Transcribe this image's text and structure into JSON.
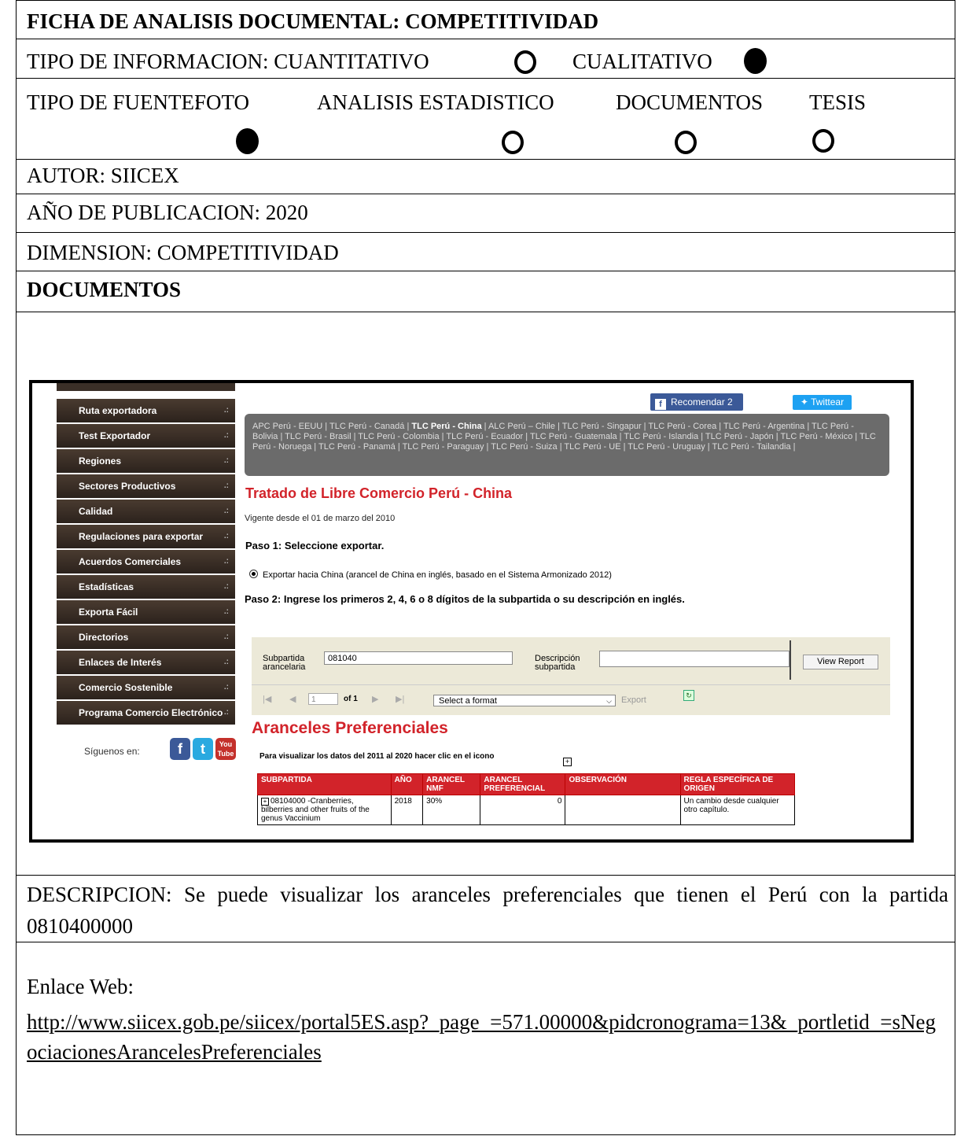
{
  "title": "FICHA DE ANALISIS DOCUMENTAL: COMPETITIVIDAD",
  "tipo_informacion": {
    "label": "TIPO DE INFORMACION: CUANTITATIVO",
    "cualitativo": "CUALITATIVO",
    "selected": "CUALITATIVO"
  },
  "tipo_fuente": {
    "label": "TIPO DE FUENTE:",
    "options": [
      "FOTO",
      "ANALISIS ESTADISTICO",
      "DOCUMENTOS",
      "TESIS"
    ],
    "selected": "FOTO"
  },
  "autor": "AUTOR: SIICEX",
  "anio": "AÑO DE PUBLICACION: 2020",
  "dimension": "DIMENSION: COMPETITIVIDAD",
  "documentos": "DOCUMENTOS",
  "screenshot": {
    "sidebar": [
      "Ruta exportadora",
      "Test Exportador",
      "Regiones",
      "Sectores Productivos",
      "Calidad",
      "Regulaciones para exportar",
      "Acuerdos Comerciales",
      "Estadísticas",
      "Exporta Fácil",
      "Directorios",
      "Enlaces de Interés",
      "Comercio Sostenible",
      "Programa Comercio Electrónico"
    ],
    "siguenos": "Síguenos en:",
    "recomendar": "Recomendar 2",
    "twittear": "Twittear",
    "tlc_pre": "APC Perú - EEUU | TLC Perú - Canadá | ",
    "tlc_bold": "TLC Perú - China",
    "tlc_post": " | ALC Perú – Chile | TLC Perú - Singapur | TLC Perú - Corea | TLC Perú - Argentina | TLC Perú - Bolivia | TLC Perú - Brasil | TLC Perú - Colombia | TLC Perú - Ecuador | TLC Perú - Guatemala | TLC Perú - Islandia | TLC Perú - Japón | TLC Perú - México | TLC Perú - Noruega | TLC Perú - Panamá | TLC Perú - Paraguay | TLC Perú - Suiza | TLC Perú - UE | TLC Perú - Uruguay | TLC Perú - Tailandia |",
    "tratado": "Tratado de Libre Comercio Perú - China",
    "vigente": "Vigente desde el 01 de marzo del 2010",
    "paso1": "Paso 1: Seleccione exportar.",
    "exportar_option": "Exportar hacia China (arancel de China en inglés, basado en el Sistema Armonizado 2012)",
    "paso2": "Paso 2: Ingrese los primeros 2, 4, 6 o 8 dígitos de la subpartida o su descripción en inglés.",
    "subpartida_label_1": "Subpartida",
    "subpartida_label_2": "arancelaria",
    "subpartida_value": "081040",
    "descripcion_label_1": "Descripción",
    "descripcion_label_2": "subpartida",
    "view_report": "View Report",
    "page_value": "1",
    "of_pages": "of 1",
    "select_format": "Select a format",
    "export": "Export",
    "aranceles_title": "Aranceles Preferenciales",
    "visualizar_note": "Para visualizar los datos del 2011 al 2020 hacer clic en el icono",
    "table_headers": [
      "SUBPARTIDA",
      "AÑO",
      "ARANCEL NMF",
      "ARANCEL PREFERENCIAL",
      "OBSERVACIÓN",
      "REGLA ESPECÍFICA DE ORIGEN"
    ],
    "table_row": [
      "08104000 -Cranberries, bilberries and other fruits of the genus Vaccinium",
      "2018",
      "30%",
      "0",
      "",
      "Un cambio desde cualquier otro capítulo."
    ]
  },
  "descripcion": "DESCRIPCION: Se puede visualizar los aranceles preferenciales que tienen el Perú con la partida 0810400000",
  "enlace_label": "Enlace Web:",
  "enlace_url": "http://www.siicex.gob.pe/siicex/portal5ES.asp?_page_=571.00000&pidcronograma=13&_portletid_=sNegociacionesArancelesPreferenciales"
}
